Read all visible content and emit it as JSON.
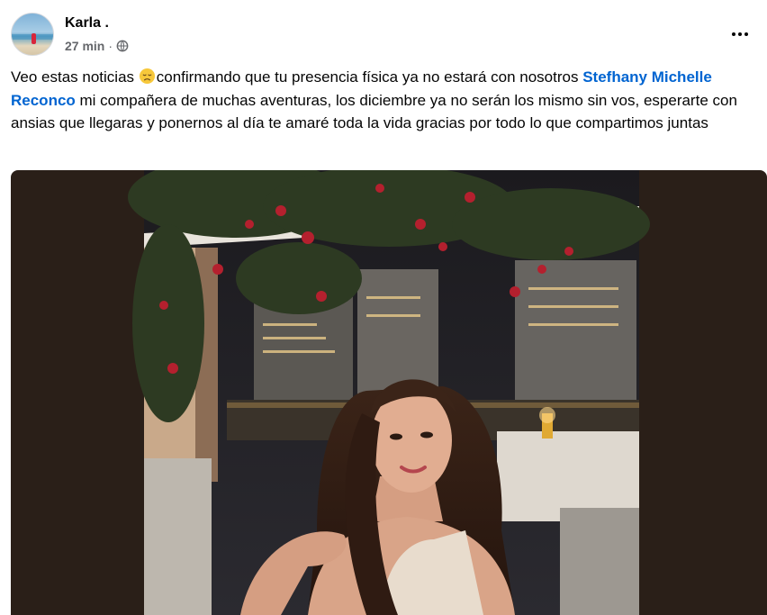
{
  "post": {
    "author": "Karla .",
    "timestamp": "27 min",
    "separator": "·",
    "privacy_icon": "globe-icon",
    "more_icon": "ellipsis-icon",
    "text_part1": "Veo estas noticias ",
    "emoji": "disappointed-face-emoji",
    "text_part2": "confirmando que tu presencia física ya no estará con nosotros ",
    "mention": "Stefhany Michelle Reconco",
    "text_part3": " mi compañera de muchas aventuras, los diciembre ya no serán los mismo sin vos, esperarte con ansias que llegaras y ponernos al día te amaré toda la vida gracias por todo lo que compartimos juntas"
  },
  "colors": {
    "mention": "#0064d1",
    "meta_text": "#65676b",
    "photo_letterbox": "#2a1f18"
  }
}
